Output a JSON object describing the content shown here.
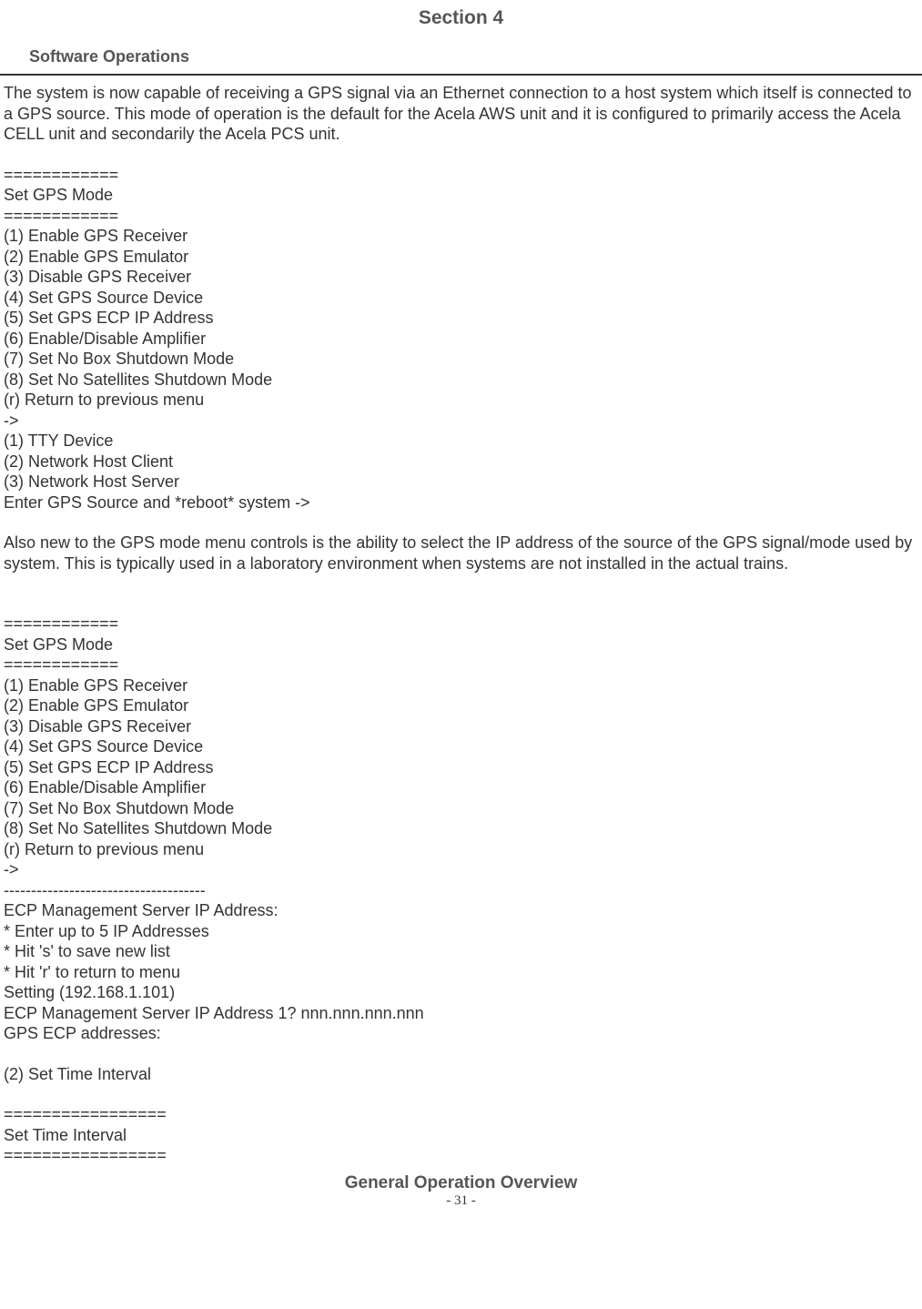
{
  "header": {
    "section_title": "Section 4",
    "subtitle": "Software Operations"
  },
  "body": {
    "intro": "The system is now capable of receiving a GPS signal via an Ethernet connection to a host system which itself is connected to a GPS source. This mode of operation is the default for the Acela AWS unit and it is configured to primarily access the Acela CELL unit and secondarily the Acela PCS unit.",
    "block1": {
      "sep1": "============",
      "title": "Set GPS Mode",
      "sep2": "============",
      "opt1": "(1) Enable GPS Receiver",
      "opt2": "(2) Enable GPS Emulator",
      "opt3": "(3) Disable GPS Receiver",
      "opt4": "(4) Set GPS Source Device",
      "opt5": "(5) Set GPS ECP IP Address",
      "opt6": "(6) Enable/Disable Amplifier",
      "opt7": "(7) Set No Box Shutdown Mode",
      "opt8": "(8) Set No Satellites Shutdown Mode",
      "optr": "(r) Return to previous menu",
      "prompt": "->",
      "sub1": "(1) TTY Device",
      "sub2": "(2) Network Host Client",
      "sub3": "(3) Network Host Server",
      "enter": "Enter GPS Source and *reboot* system ->"
    },
    "mid": "Also new to the GPS mode menu controls is the ability to select the IP address of the source of the GPS signal/mode used by system. This is typically used in a laboratory environment when systems are not installed in the actual trains.",
    "block2": {
      "sep1": "============",
      "title": "Set GPS Mode",
      "sep2": "============",
      "opt1": "(1) Enable GPS Receiver",
      "opt2": "(2) Enable GPS Emulator",
      "opt3": "(3) Disable GPS Receiver",
      "opt4": "(4) Set GPS Source Device",
      "opt5": "(5) Set GPS ECP IP Address",
      "opt6": "(6) Enable/Disable Amplifier",
      "opt7": "(7) Set No Box Shutdown Mode",
      "opt8": "(8) Set No Satellites Shutdown Mode",
      "optr": "(r) Return to previous menu",
      "prompt": "->",
      "dashes": "-------------------------------------",
      "ecp_title": "ECP Management Server IP Address:",
      "ecp_l1": "* Enter up to 5 IP Addresses",
      "ecp_l2": "* Hit 's' to save new list",
      "ecp_l3": "* Hit 'r' to return to menu",
      "setting": "Setting (192.168.1.101)",
      "ecp_q": "ECP Management Server IP Address 1? nnn.nnn.nnn.nnn",
      "gps_ecp": "GPS ECP addresses:",
      "set_time": "(2) Set Time Interval",
      "sep3": "=================",
      "sti_title": "Set Time Interval",
      "sep4": "================="
    }
  },
  "footer": {
    "title": "General Operation Overview",
    "page": "- 31 -"
  }
}
